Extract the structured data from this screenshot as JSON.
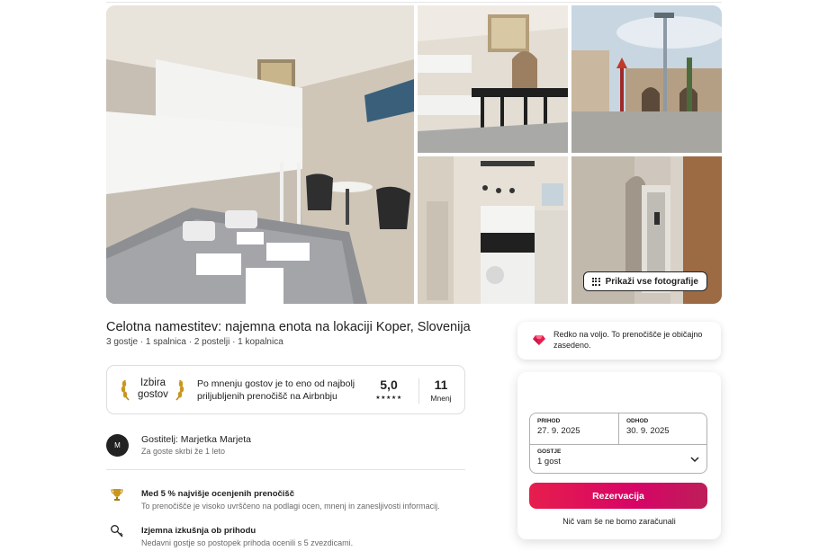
{
  "gallery": {
    "photos": [
      {
        "name": "bedroom-main-photo",
        "alt": "bedroom with bunk bed"
      },
      {
        "name": "bunk-kitchen-photo",
        "alt": "bunk beds and bar stools"
      },
      {
        "name": "koper-square-photo",
        "alt": "Koper town square"
      },
      {
        "name": "kitchen-photo",
        "alt": "kitchenette"
      },
      {
        "name": "hallway-mirror-photo",
        "alt": "hallway with mirror"
      }
    ],
    "show_all_label": "Prikaži vse fotografije",
    "show_all_icon": "grid-icon"
  },
  "listing": {
    "title": "Celotna namestitev: najemna enota na lokaciji Koper, Slovenija",
    "summary": "3 gostje · 1 spalnica · 2 postelji · 1 kopalnica"
  },
  "guest_favorite": {
    "badge_line1": "Izbira",
    "badge_line2": "gostov",
    "description": "Po mnenju gostov je to eno od najbolj priljubljenih prenočišč na Airbnbju",
    "rating": "5,0",
    "stars": "★★★★★",
    "reviews_count": "11",
    "reviews_label": "Mnenj"
  },
  "host": {
    "initial": "M",
    "name": "Gostitelj: Marjetka Marjeta",
    "tenure": "Za goste skrbi že 1 leto"
  },
  "highlights": [
    {
      "icon": "trophy-icon",
      "title": "Med 5 % najvišje ocenjenih prenočišč",
      "subtitle": "To prenočišče je visoko uvrščeno na podlagi ocen, mnenj in zanesljivosti informacij."
    },
    {
      "icon": "key-icon",
      "title": "Izjemna izkušnja ob prihodu",
      "subtitle": "Nedavni gostje so postopek prihoda ocenili s 5 zvezdicami."
    }
  ],
  "rare_find": {
    "icon": "gem-icon",
    "text": "Redko na voljo. To prenočišče je običajno zasedeno."
  },
  "booking": {
    "checkin_label": "Prihod",
    "checkin_value": "27. 9. 2025",
    "checkout_label": "Odhod",
    "checkout_value": "30. 9. 2025",
    "guests_label": "Gostje",
    "guests_value": "1 gost",
    "reserve_label": "Rezervacija",
    "no_charge_note": "Nič vam še ne bomo zaračunali",
    "accent_color": "#e61e4d"
  }
}
